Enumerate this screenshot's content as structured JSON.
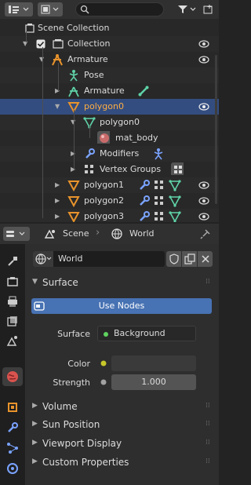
{
  "outliner": {
    "rows": [
      {
        "label": "Scene Collection"
      },
      {
        "label": "Collection"
      },
      {
        "label": "Armature"
      },
      {
        "label": "Pose"
      },
      {
        "label": "Armature"
      },
      {
        "label": "polygon0"
      },
      {
        "label": "polygon0"
      },
      {
        "label": "mat_body"
      },
      {
        "label": "Modifiers"
      },
      {
        "label": "Vertex Groups"
      },
      {
        "label": "polygon1"
      },
      {
        "label": "polygon2"
      },
      {
        "label": "polygon3"
      }
    ]
  },
  "props_header": {
    "scene_label": "Scene",
    "world_label": "World"
  },
  "world_selector": {
    "name": "World"
  },
  "surface_panel": {
    "title": "Surface",
    "use_nodes_label": "Use Nodes",
    "surface_label": "Surface",
    "surface_value": "Background",
    "color_label": "Color",
    "strength_label": "Strength",
    "strength_value": "1.000"
  },
  "collapsed_panels": [
    {
      "title": "Volume"
    },
    {
      "title": "Sun Position"
    },
    {
      "title": "Viewport Display"
    },
    {
      "title": "Custom Properties"
    }
  ],
  "colors": {
    "selection": "#334d80",
    "use_nodes": "#4772b3",
    "object_orange": "#e8932c",
    "mesh_green": "#5fd3a8",
    "world_red": "#d9534f"
  }
}
